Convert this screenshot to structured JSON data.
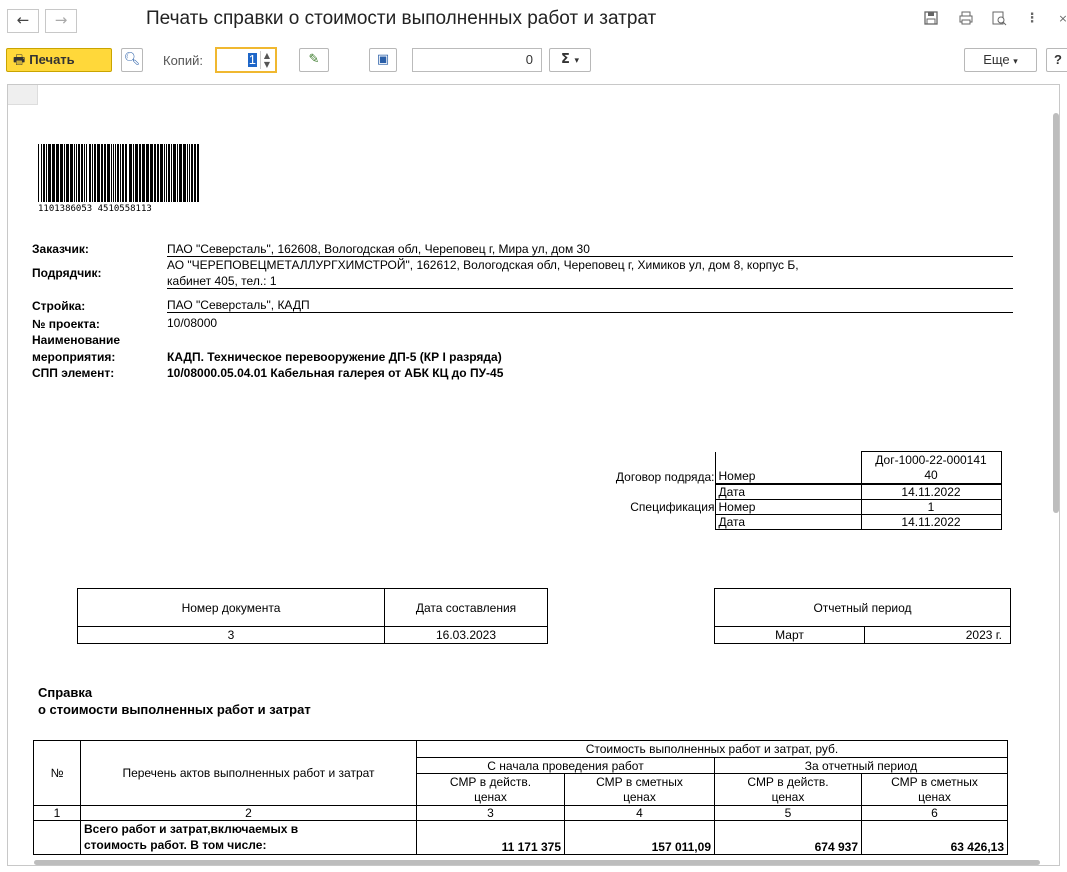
{
  "window": {
    "title": "Печать справки о стоимости выполненных работ и затрат",
    "nav_back": "←",
    "nav_forward": "→",
    "icons": [
      "save-icon",
      "print-icon",
      "preview-icon",
      "more-vert-icon",
      "close-icon"
    ]
  },
  "toolbar": {
    "print_label": "Печать",
    "copies_label": "Копий:",
    "copies_value": "1",
    "sum_value": "0",
    "sum_label": "Σ",
    "more_label": "Еще",
    "help_label": "?"
  },
  "document": {
    "barcode_text": "1101386053 4510558113",
    "customer_label": "Заказчик:",
    "customer_value": "ПАО \"Северсталь\", 162608, Вологодская обл, Череповец г, Мира ул, дом 30",
    "contractor_label": "Подрядчик:",
    "contractor_value_line1": "АО \"ЧЕРЕПОВЕЦМЕТАЛЛУРГХИМСТРОЙ\", 162612, Вологодская обл, Череповец г, Химиков ул, дом 8, корпус Б,",
    "contractor_value_line2": "кабинет 405, тел.: 1",
    "site_label": "Стройка:",
    "site_value": "ПАО \"Северсталь\", КАДП",
    "project_label": "№ проекта:",
    "project_value": "10/08000",
    "event_label_line1": "Наименование",
    "event_label_line2": "мероприятия:",
    "event_value": "КАДП. Техническое перевооружение ДП-5 (КР I разряда)",
    "spp_label": "СПП элемент:",
    "spp_value": "10/08000.05.04.01 Кабельная галерея от АБК КЦ до ПУ-45",
    "contract": {
      "contract_label": "Договор подряда:",
      "number_label": "Номер",
      "number_value_line1": "Дог-1000-22-000141",
      "number_value_line2": "40",
      "date_label": "Дата",
      "date_value": "14.11.2022",
      "spec_label": "Спецификация",
      "spec_number_label": "Номер",
      "spec_number_value": "1",
      "spec_date_label": "Дата",
      "spec_date_value": "14.11.2022"
    },
    "docnum": {
      "h1": "Номер документа",
      "h2": "Дата составления",
      "v1": "3",
      "v2": "16.03.2023"
    },
    "period": {
      "header": "Отчетный период",
      "month": "Март",
      "year": "2023 г."
    },
    "heading_line1": "Справка",
    "heading_line2": "о стоимости выполненных работ и затрат",
    "table": {
      "col_num": "№",
      "col_list": "Перечень актов выполненных работ и затрат",
      "cost_header": "Стоимость выполненных работ и затрат, руб.",
      "from_start": "С начала проведения работ",
      "for_period": "За отчетный период",
      "smr_actual_1": "СМР в действ.",
      "smr_actual_2": "ценах",
      "smr_est_1": "СМР в сметных",
      "smr_est_2": "ценах",
      "colnums": [
        "1",
        "2",
        "3",
        "4",
        "5",
        "6"
      ],
      "row_total_line1": "Всего работ и затрат,включаемых в",
      "row_total_line2": "стоимость работ. В том числе:",
      "row_total_values": [
        "11 171 375",
        "157 011,09",
        "674 937",
        "63 426,13"
      ]
    }
  }
}
